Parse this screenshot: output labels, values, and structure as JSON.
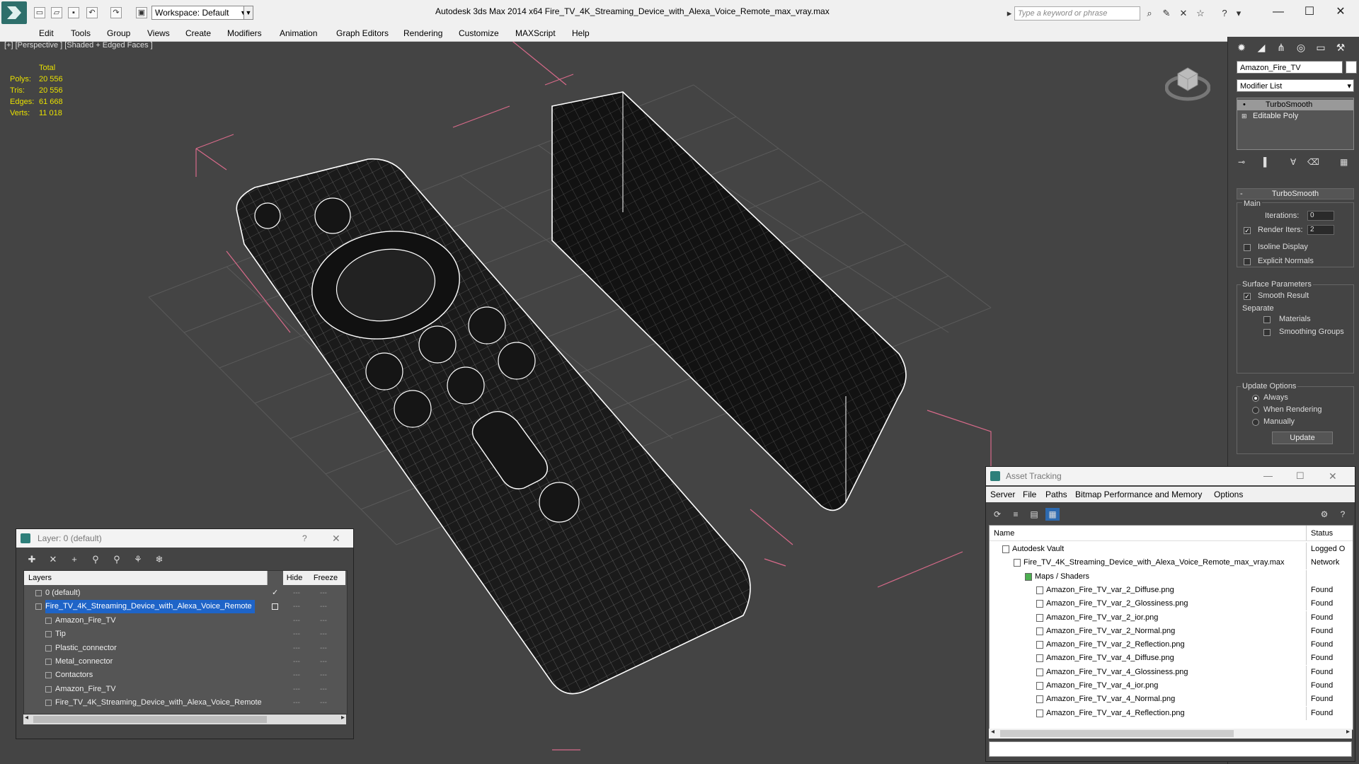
{
  "app": {
    "title": "Autodesk 3ds Max  2014 x64     Fire_TV_4K_Streaming_Device_with_Alexa_Voice_Remote_max_vray.max",
    "workspace": "Workspace: Default",
    "search_placeholder": "Type a keyword or phrase"
  },
  "menu": [
    "Edit",
    "Tools",
    "Group",
    "Views",
    "Create",
    "Modifiers",
    "Animation",
    "Graph Editors",
    "Rendering",
    "Customize",
    "MAXScript",
    "Help"
  ],
  "viewport": {
    "label": "[+] [Perspective ] [Shaded + Edged Faces ]",
    "stats": {
      "header": "Total",
      "rows": [
        {
          "k": "Polys:",
          "v": "20 556"
        },
        {
          "k": "Tris:",
          "v": "20 556"
        },
        {
          "k": "Edges:",
          "v": "61 668"
        },
        {
          "k": "Verts:",
          "v": "11 018"
        }
      ]
    }
  },
  "command_panel": {
    "object_name": "Amazon_Fire_TV",
    "modifier_list": "Modifier List",
    "stack": [
      "TurboSmooth",
      "Editable Poly"
    ],
    "rollout_title": "TurboSmooth",
    "main_label": "Main",
    "iterations_label": "Iterations:",
    "iterations_value": "0",
    "render_iters_label": "Render Iters:",
    "render_iters_value": "2",
    "isoline_display": "Isoline Display",
    "explicit_normals": "Explicit Normals",
    "surface_params": "Surface Parameters",
    "smooth_result": "Smooth Result",
    "separate": "Separate",
    "materials": "Materials",
    "smoothing_groups": "Smoothing Groups",
    "update_options": "Update Options",
    "always": "Always",
    "when_rendering": "When Rendering",
    "manually": "Manually",
    "update_button": "Update"
  },
  "layer_dialog": {
    "title": "Layer: 0 (default)",
    "help": "?",
    "columns": {
      "layers": "Layers",
      "hide": "Hide",
      "freeze": "Freeze"
    },
    "rows": [
      {
        "name": "0 (default)",
        "indent": 0,
        "selected": false,
        "check": true
      },
      {
        "name": "Fire_TV_4K_Streaming_Device_with_Alexa_Voice_Remote",
        "indent": 0,
        "selected": true,
        "check": false
      },
      {
        "name": "Amazon_Fire_TV",
        "indent": 1,
        "selected": false,
        "check": false
      },
      {
        "name": "Tip",
        "indent": 1,
        "selected": false,
        "check": false
      },
      {
        "name": "Plastic_connector",
        "indent": 1,
        "selected": false,
        "check": false
      },
      {
        "name": "Metal_connector",
        "indent": 1,
        "selected": false,
        "check": false
      },
      {
        "name": "Contactors",
        "indent": 1,
        "selected": false,
        "check": false
      },
      {
        "name": "Amazon_Fire_TV",
        "indent": 1,
        "selected": false,
        "check": false
      },
      {
        "name": "Fire_TV_4K_Streaming_Device_with_Alexa_Voice_Remote",
        "indent": 1,
        "selected": false,
        "check": false
      }
    ]
  },
  "asset_dialog": {
    "title": "Asset Tracking",
    "menu": [
      "Server",
      "File",
      "Paths",
      "Bitmap Performance and Memory",
      "Options"
    ],
    "columns": {
      "name": "Name",
      "status": "Status"
    },
    "rows": [
      {
        "name": "Autodesk Vault",
        "indent": 0,
        "status": "Logged O"
      },
      {
        "name": "Fire_TV_4K_Streaming_Device_with_Alexa_Voice_Remote_max_vray.max",
        "indent": 1,
        "status": "Network"
      },
      {
        "name": "Maps / Shaders",
        "indent": 2,
        "status": ""
      },
      {
        "name": "Amazon_Fire_TV_var_2_Diffuse.png",
        "indent": 3,
        "status": "Found"
      },
      {
        "name": "Amazon_Fire_TV_var_2_Glossiness.png",
        "indent": 3,
        "status": "Found"
      },
      {
        "name": "Amazon_Fire_TV_var_2_ior.png",
        "indent": 3,
        "status": "Found"
      },
      {
        "name": "Amazon_Fire_TV_var_2_Normal.png",
        "indent": 3,
        "status": "Found"
      },
      {
        "name": "Amazon_Fire_TV_var_2_Reflection.png",
        "indent": 3,
        "status": "Found"
      },
      {
        "name": "Amazon_Fire_TV_var_4_Diffuse.png",
        "indent": 3,
        "status": "Found"
      },
      {
        "name": "Amazon_Fire_TV_var_4_Glossiness.png",
        "indent": 3,
        "status": "Found"
      },
      {
        "name": "Amazon_Fire_TV_var_4_ior.png",
        "indent": 3,
        "status": "Found"
      },
      {
        "name": "Amazon_Fire_TV_var_4_Normal.png",
        "indent": 3,
        "status": "Found"
      },
      {
        "name": "Amazon_Fire_TV_var_4_Reflection.png",
        "indent": 3,
        "status": "Found"
      }
    ]
  },
  "colors": {
    "stats_yellow": "#e8e000",
    "selection_blue": "#1e64c8",
    "wire_white": "#ffffff",
    "bbox_pink": "#d86a8a",
    "grid": "#5a5a5a"
  }
}
